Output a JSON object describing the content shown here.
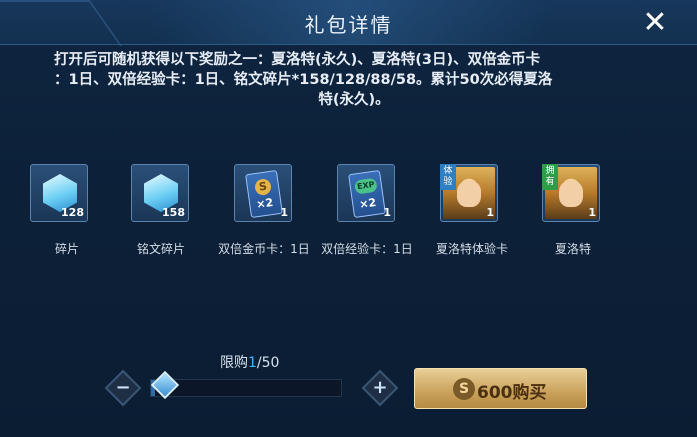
{
  "header": {
    "title": "礼包详情",
    "close_label": "✕"
  },
  "description": {
    "line1": "打开后可随机获得以下奖励之一：夏洛特(永久)、夏洛特(3日)、双倍金币卡",
    "line2": "：1日、双倍经验卡：1日、铭文碎片*158/128/88/58。累计50次必得夏洛",
    "line3": "特(永久)。"
  },
  "items": [
    {
      "name": "碎片",
      "qty": "128",
      "icon": "inscription-shard-icon"
    },
    {
      "name": "铭文碎片",
      "qty": "158",
      "icon": "inscription-shard-icon"
    },
    {
      "name": "双倍金币卡：1日",
      "qty": "1",
      "icon": "gold-card-icon",
      "card_coin": "S",
      "card_mult": "×2"
    },
    {
      "name": "双倍经验卡：1日",
      "qty": "1",
      "icon": "exp-card-icon",
      "card_exp": "EXP",
      "card_mult": "×2"
    },
    {
      "name": "夏洛特体验卡",
      "qty": "1",
      "icon": "hero-portrait-icon",
      "tag": "体验"
    },
    {
      "name": "夏洛特",
      "qty": "1",
      "icon": "hero-portrait-icon",
      "tag": "拥有"
    }
  ],
  "purchase": {
    "limit_label": "限购",
    "limit_current": "1",
    "limit_total": "/50",
    "slider_fraction": 0.02,
    "minus": "−",
    "plus": "+",
    "buy_coin": "S",
    "buy_label": "600购买"
  },
  "colors": {
    "accent_blue": "#4ab1ff",
    "button_gold": "#caa25b"
  }
}
